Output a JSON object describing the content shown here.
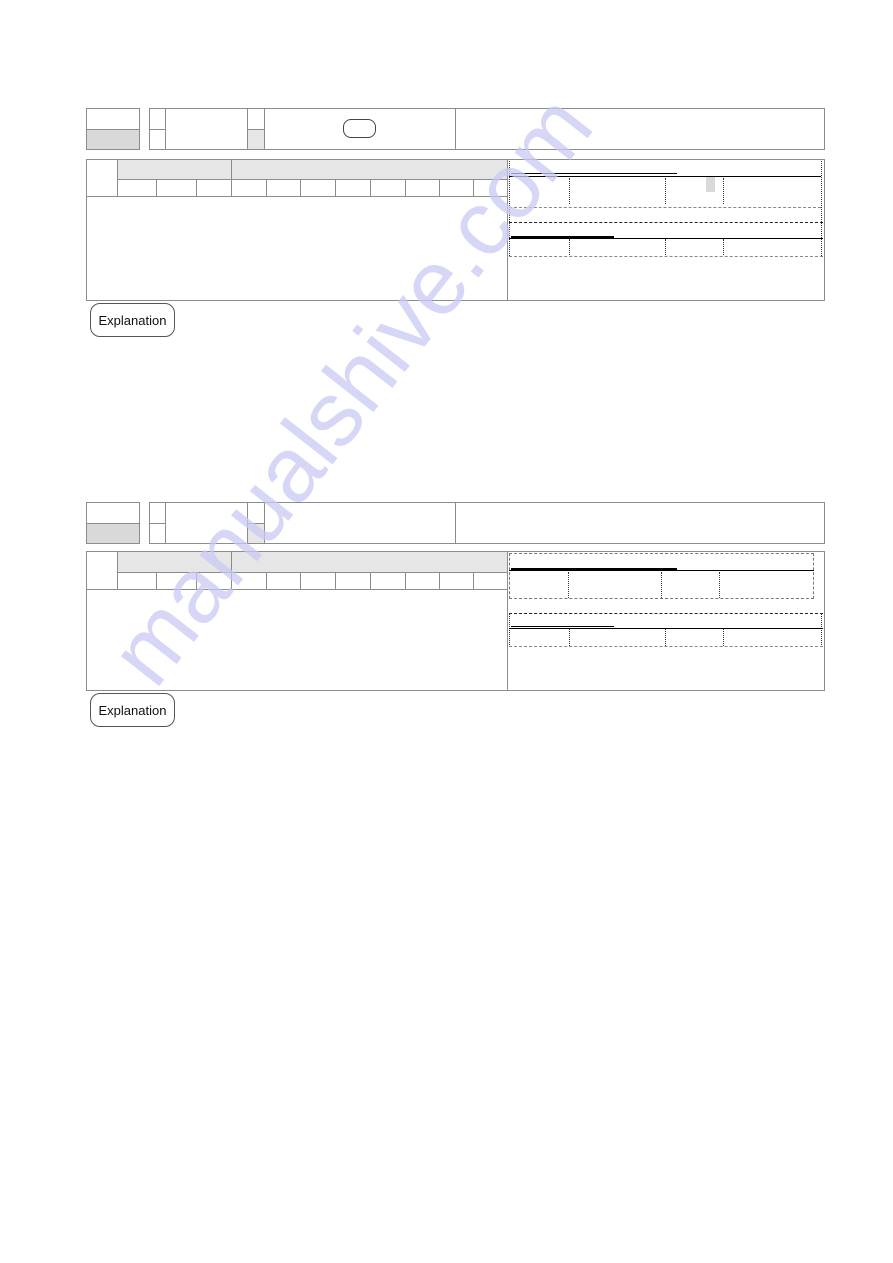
{
  "page": {
    "sections": [
      {
        "explanation_label": "Explanation",
        "header_cells": [
          "",
          "",
          "",
          "",
          "",
          "",
          ""
        ],
        "table_headers": [
          "",
          ""
        ],
        "table_subcells": [
          "",
          "",
          "",
          "",
          "",
          "",
          "",
          "",
          "",
          "",
          ""
        ],
        "has_key_button": true
      },
      {
        "explanation_label": "Explanation",
        "header_cells": [
          "",
          "",
          "",
          "",
          "",
          "",
          ""
        ],
        "table_headers": [
          "",
          ""
        ],
        "table_subcells": [
          "",
          "",
          "",
          "",
          "",
          "",
          "",
          "",
          "",
          "",
          ""
        ],
        "has_key_button": false
      }
    ],
    "watermark": "manualshive.com"
  }
}
